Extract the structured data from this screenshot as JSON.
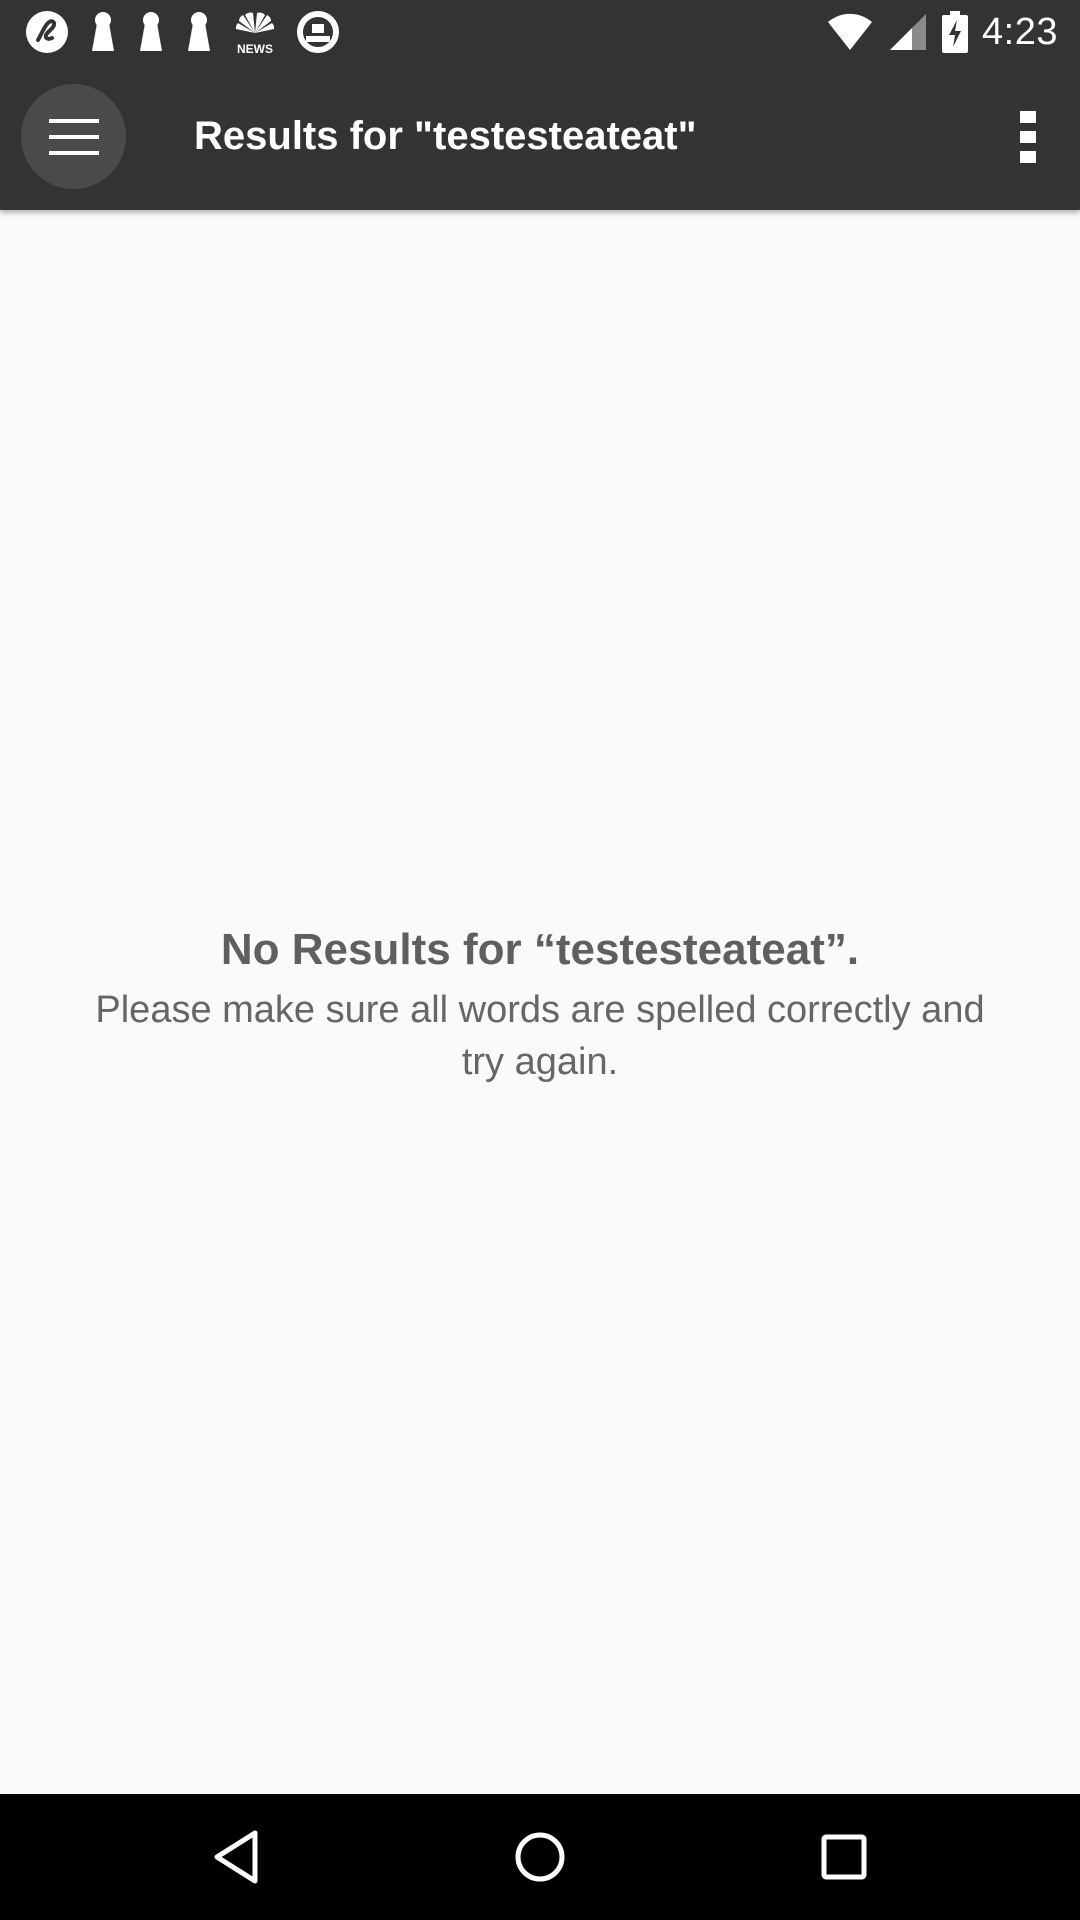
{
  "status_bar": {
    "time": "4:23",
    "notification_icons": [
      "app-notification-icon",
      "keyhole-icon",
      "keyhole-icon",
      "keyhole-icon",
      "nbc-news-icon",
      "app-notification-icon"
    ],
    "nbc_news_label": "NEWS",
    "system_icons": [
      "wifi-icon",
      "cell-signal-icon",
      "battery-charging-icon"
    ]
  },
  "app_bar": {
    "title": "Results for \"testesteateat\"",
    "menu_icon": "hamburger-menu-icon",
    "overflow_icon": "more-vert-icon",
    "background": "#333333"
  },
  "empty_state": {
    "heading": "No Results for “testesteateat”.",
    "message": "Please make sure all words are spelled correctly and try again."
  },
  "nav_bar": {
    "icons": [
      "back-icon",
      "home-icon",
      "recents-icon"
    ]
  }
}
